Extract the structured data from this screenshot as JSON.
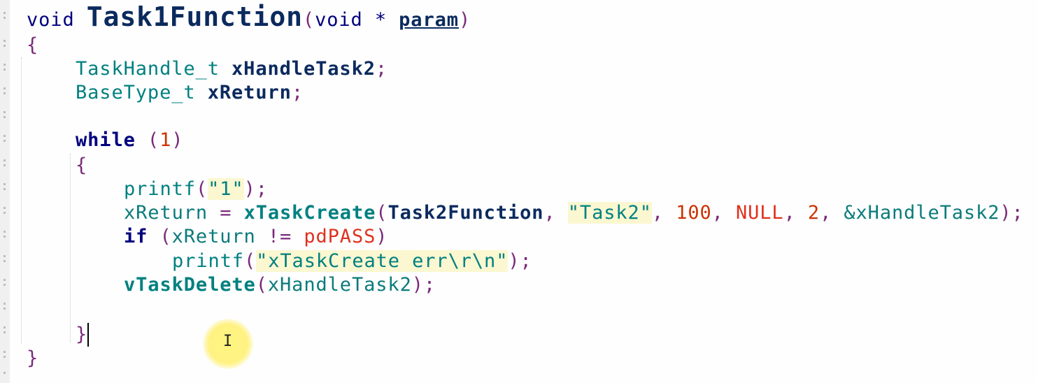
{
  "editor": {
    "lines": {
      "l1": {
        "kw_void": "void",
        "fn_name": "Task1Function",
        "open": "(",
        "kw_void2": "void",
        "star": " * ",
        "param": "param",
        "close": ")"
      },
      "l2": {
        "brace": "{"
      },
      "l3": {
        "type": "TaskHandle_t",
        "name": "xHandleTask2",
        "semi": ";"
      },
      "l4": {
        "type": "BaseType_t",
        "name": "xReturn",
        "semi": ";"
      },
      "l6": {
        "kw": "while",
        "open": " (",
        "num": "1",
        "close": ")"
      },
      "l7": {
        "brace": "{"
      },
      "l8": {
        "fn": "printf",
        "open": "(",
        "str": "\"1\"",
        "close": ");"
      },
      "l9": {
        "var": "xReturn",
        "eq": " = ",
        "fn": "xTaskCreate",
        "open": "(",
        "arg1": "Task2Function",
        "c1": ", ",
        "arg2": "\"Task2\"",
        "c2": ", ",
        "arg3": "100",
        "c3": ", ",
        "arg4": "NULL",
        "c4": ", ",
        "arg5": "2",
        "c5": ", ",
        "arg6": "&xHandleTask2",
        "close": ");"
      },
      "l10": {
        "kw": "if",
        "open": " (",
        "var": "xReturn",
        "op": " != ",
        "const": "pdPASS",
        "close": ")"
      },
      "l11": {
        "fn": "printf",
        "open": "(",
        "str": "\"xTaskCreate err\\r\\n\"",
        "close": ");"
      },
      "l12": {
        "fn": "vTaskDelete",
        "open": "(",
        "arg": "xHandleTask2",
        "close": ");"
      },
      "l14": {
        "brace": "}"
      },
      "l15": {
        "brace": "}"
      }
    },
    "icons": {
      "text_cursor": "I"
    }
  }
}
